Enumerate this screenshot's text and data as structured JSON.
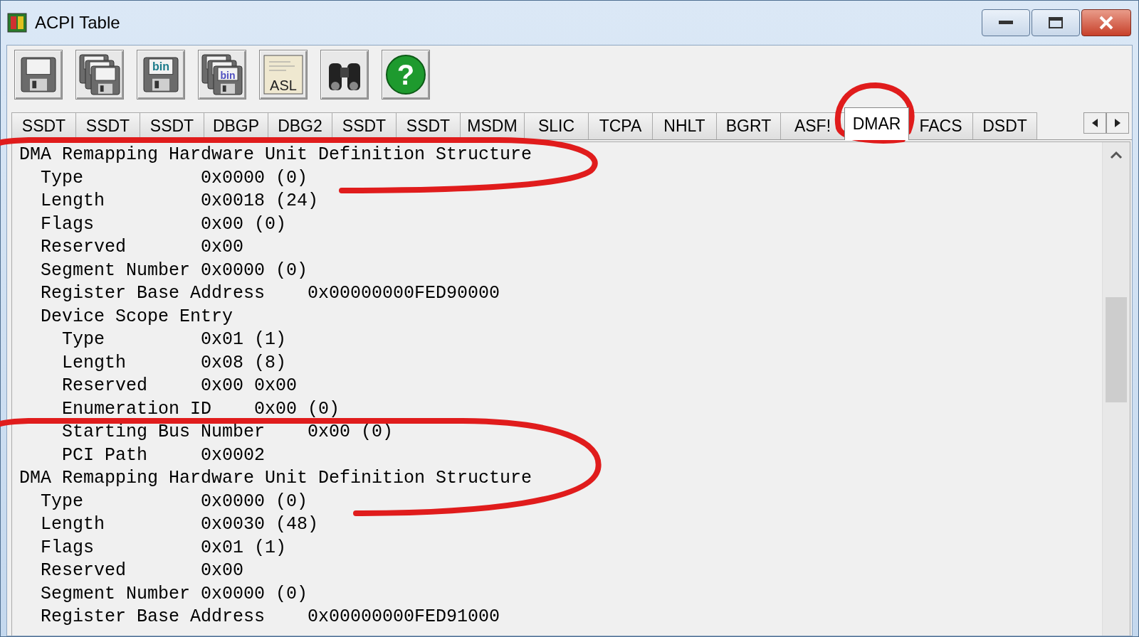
{
  "window": {
    "title": "ACPI Table"
  },
  "toolbar": [
    {
      "kind": "floppy"
    },
    {
      "kind": "floppies"
    },
    {
      "kind": "floppy",
      "label": "bin"
    },
    {
      "kind": "floppies",
      "label": "bin"
    },
    {
      "kind": "document",
      "label": "ASL"
    },
    {
      "kind": "binoculars"
    },
    {
      "kind": "help",
      "label": "?"
    }
  ],
  "tabs": [
    {
      "label": "SSDT",
      "selected": false
    },
    {
      "label": "SSDT",
      "selected": false
    },
    {
      "label": "SSDT",
      "selected": false
    },
    {
      "label": "DBGP",
      "selected": false
    },
    {
      "label": "DBG2",
      "selected": false
    },
    {
      "label": "SSDT",
      "selected": false
    },
    {
      "label": "SSDT",
      "selected": false
    },
    {
      "label": "MSDM",
      "selected": false
    },
    {
      "label": "SLIC",
      "selected": false
    },
    {
      "label": "TCPA",
      "selected": false
    },
    {
      "label": "NHLT",
      "selected": false
    },
    {
      "label": "BGRT",
      "selected": false
    },
    {
      "label": "ASF!",
      "selected": false
    },
    {
      "label": "DMAR",
      "selected": true
    },
    {
      "label": "FACS",
      "selected": false
    },
    {
      "label": "DSDT",
      "selected": false
    }
  ],
  "content": [
    {
      "label": "DMA Remapping Hardware Unit Definition Structure",
      "children": [
        {
          "label": "Type",
          "value": "0x0000 (0)"
        },
        {
          "label": "Length",
          "value": "0x0018 (24)"
        },
        {
          "label": "Flags",
          "value": "0x00 (0)"
        },
        {
          "label": "Reserved",
          "value": "0x00"
        },
        {
          "label": "Segment Number",
          "value": "0x0000 (0)"
        },
        {
          "label": "Register Base Address",
          "value": "0x00000000FED90000"
        },
        {
          "label": "Device Scope Entry",
          "children": [
            {
              "label": "Type",
              "value": "0x01 (1)"
            },
            {
              "label": "Length",
              "value": "0x08 (8)"
            },
            {
              "label": "Reserved",
              "value": "0x00 0x00"
            },
            {
              "label": "Enumeration ID",
              "value": "0x00 (0)"
            },
            {
              "label": "Starting Bus Number",
              "value": "0x00 (0)"
            },
            {
              "label": "PCI Path",
              "value": "0x0002"
            }
          ]
        }
      ]
    },
    {
      "label": "DMA Remapping Hardware Unit Definition Structure",
      "children": [
        {
          "label": "Type",
          "value": "0x0000 (0)"
        },
        {
          "label": "Length",
          "value": "0x0030 (48)"
        },
        {
          "label": "Flags",
          "value": "0x01 (1)"
        },
        {
          "label": "Reserved",
          "value": "0x00"
        },
        {
          "label": "Segment Number",
          "value": "0x0000 (0)"
        },
        {
          "label": "Register Base Address",
          "value": "0x00000000FED91000"
        }
      ]
    }
  ],
  "annotations": [
    {
      "kind": "loop"
    },
    {
      "kind": "loop"
    },
    {
      "kind": "loop"
    }
  ]
}
